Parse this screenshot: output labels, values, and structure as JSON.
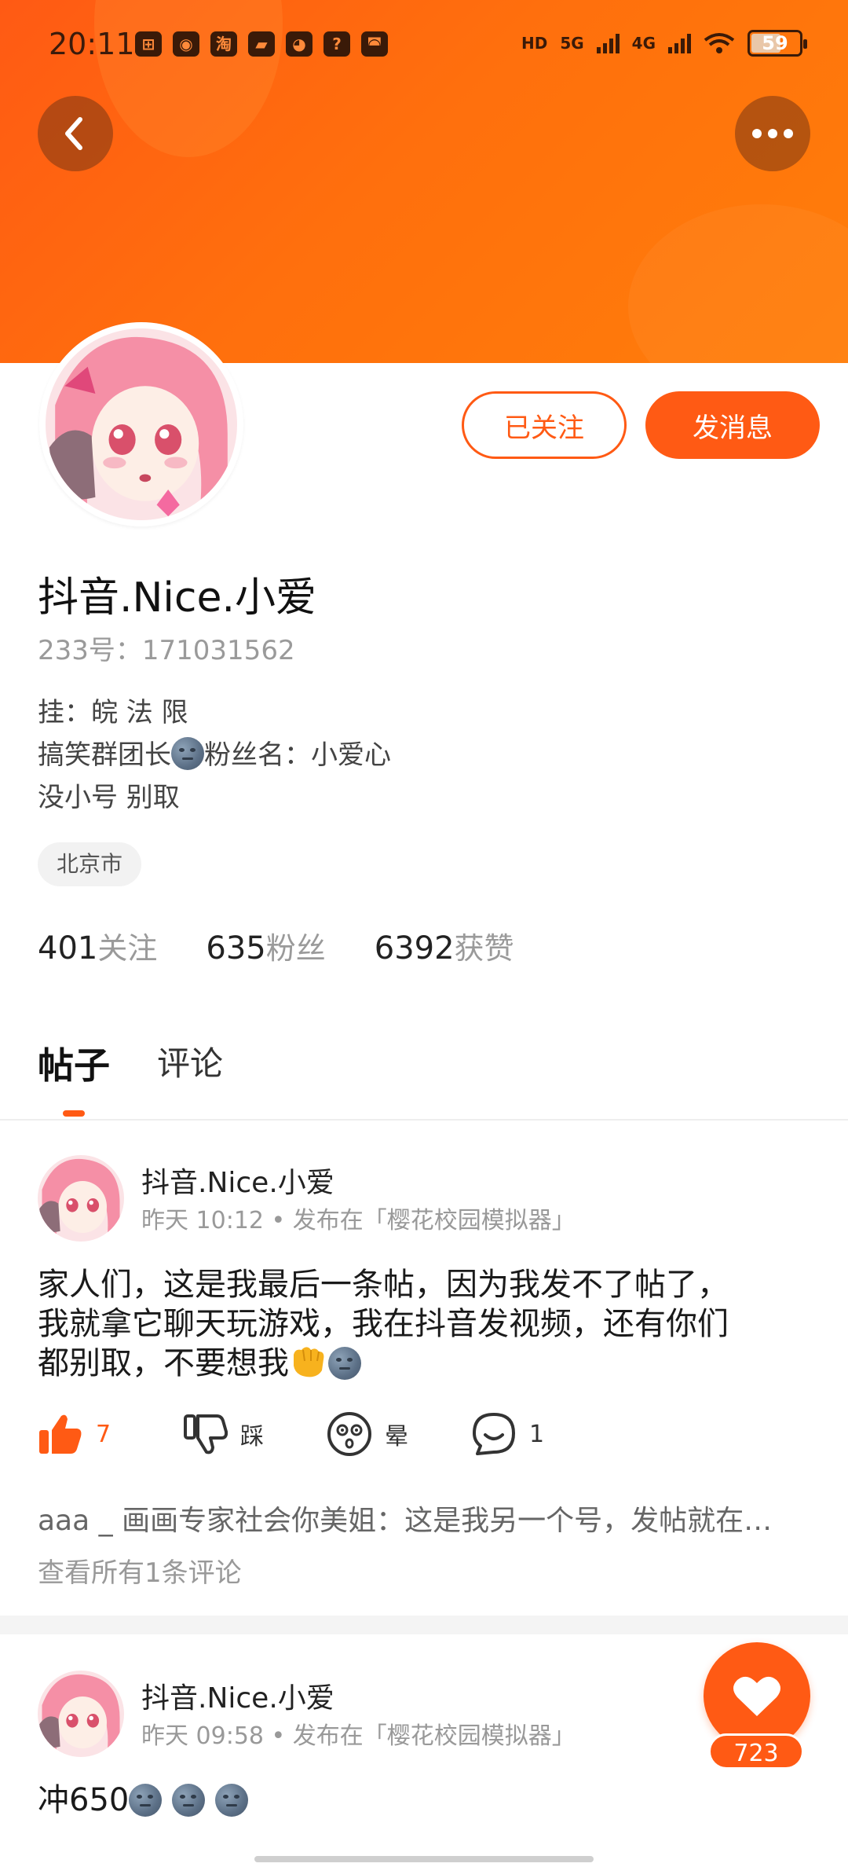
{
  "status_bar": {
    "time": "20:11",
    "app_icons": [
      "app1-icon",
      "weibo-icon",
      "taobao-icon",
      "book-icon",
      "app5-icon",
      "question-icon",
      "app7-icon"
    ],
    "app_icon_text": [
      "⊞",
      "◉",
      "淘",
      "▰",
      "◕",
      "?",
      "◚"
    ],
    "hd_label": "HD",
    "signal_1_label": "5G",
    "signal_2_label": "4G",
    "battery_level": "59"
  },
  "header": {
    "back_icon": "chevron-left-icon",
    "more_icon": "more-horizontal-icon"
  },
  "profile": {
    "follow_button": "已关注",
    "message_button": "发消息",
    "name": "抖音.Nice.小爱",
    "id_text": "233号：171031562",
    "bio_line1": "挂：皖 法 限",
    "bio_line2_a": "搞笑群团长",
    "bio_line2_b": "粉丝名：小爱心",
    "bio_line3": "没小号 别取",
    "location": "北京市",
    "stats": {
      "following_num": "401",
      "following_label": "关注",
      "fans_num": "635",
      "fans_label": "粉丝",
      "likes_num": "6392",
      "likes_label": "获赞"
    }
  },
  "tabs": {
    "posts": "帖子",
    "comments": "评论"
  },
  "posts": [
    {
      "author": "抖音.Nice.小爱",
      "meta": "昨天 10:12 • 发布在「樱花校园模拟器」",
      "text_line1": "家人们，这是我最后一条帖，因为我发不了帖了，",
      "text_line2": "我就拿它聊天玩游戏，我在抖音发视频，还有你们",
      "text_line3": "都别取，不要想我",
      "like_count": "7",
      "dislike_label": "踩",
      "dizzy_label": "晕",
      "comment_count": "1",
      "comment_preview": "aaa _ 画画专家社会你美姐：这是我另一个号，发帖就在…",
      "view_all": "查看所有1条评论"
    },
    {
      "author": "抖音.Nice.小爱",
      "meta": "昨天 09:58 • 发布在「樱花校园模拟器」",
      "text": "冲650"
    }
  ],
  "floating": {
    "heart_icon": "heart-icon",
    "count": "723"
  },
  "colors": {
    "accent": "#ff5a14",
    "banner_start": "#ff5a14",
    "banner_end": "#ff7e0a"
  }
}
